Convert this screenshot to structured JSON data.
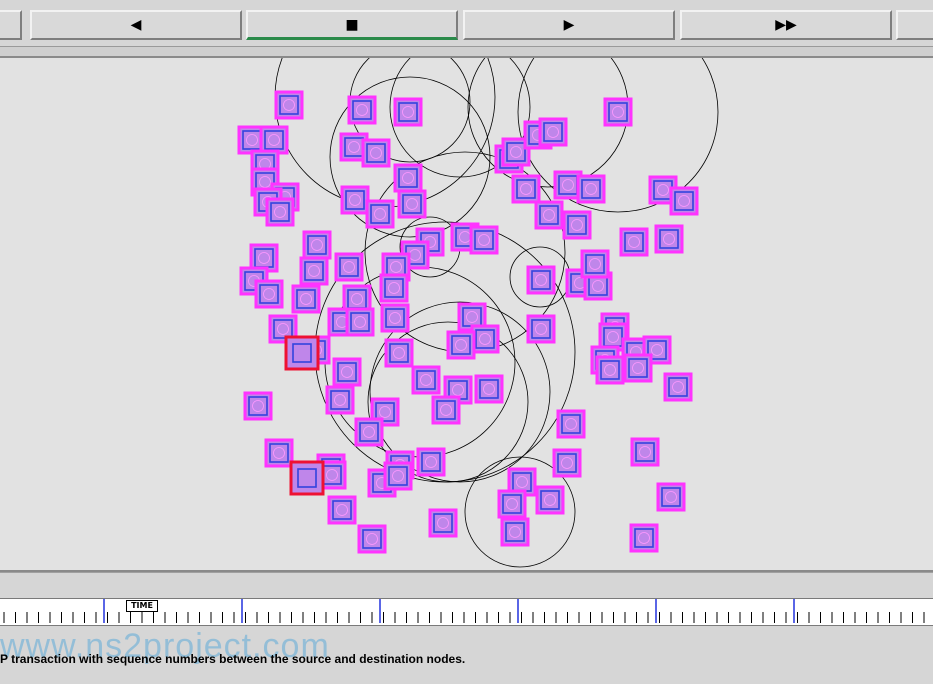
{
  "toolbar": {
    "rewind_label": "◀",
    "stop_label": "■",
    "play_label": "▶",
    "fastforward_label": "▶▶"
  },
  "timeline": {
    "marker_label": "TIME"
  },
  "watermark": "www.ns2project.com",
  "status_text": "P transaction with sequence numbers between the source and destination nodes.",
  "colors": {
    "node_outer": "#ff33ff",
    "node_inner": "#3344dd",
    "node_fill": "#bf86ea",
    "highlight": "#ee1133",
    "range": "#000000"
  }
}
